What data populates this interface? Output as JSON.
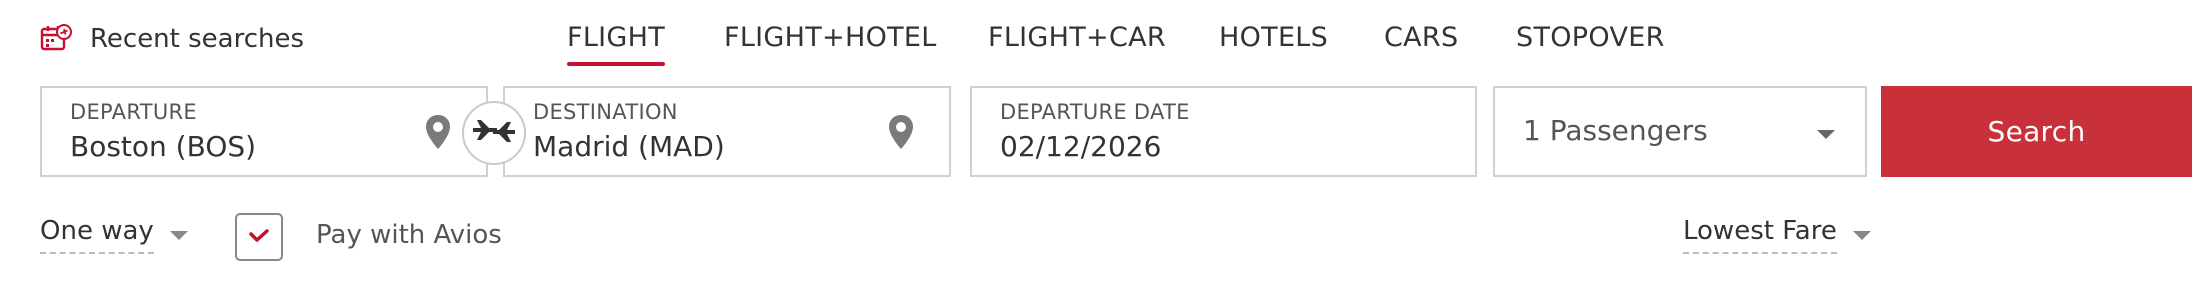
{
  "recent": {
    "label": "Recent searches",
    "icon": "calendar-plane-icon"
  },
  "tabs": [
    {
      "label": "FLIGHT",
      "active": true
    },
    {
      "label": "FLIGHT+HOTEL",
      "active": false
    },
    {
      "label": "FLIGHT+CAR",
      "active": false
    },
    {
      "label": "HOTELS",
      "active": false
    },
    {
      "label": "CARS",
      "active": false
    },
    {
      "label": "STOPOVER",
      "active": false
    }
  ],
  "form": {
    "departure": {
      "label": "DEPARTURE",
      "value": "Boston (BOS)",
      "icon": "map-pin-icon"
    },
    "destination": {
      "label": "DESTINATION",
      "value": "Madrid (MAD)",
      "icon": "map-pin-icon"
    },
    "swap": {
      "icon": "plane-swap-icon"
    },
    "date": {
      "label": "DEPARTURE DATE",
      "value": "02/12/2026"
    },
    "passengers": {
      "value": "1 Passengers"
    },
    "search_label": "Search"
  },
  "options": {
    "trip_type": "One way",
    "pay_with_avios": {
      "label": "Pay with Avios",
      "checked": true
    },
    "sort": "Lowest Fare"
  },
  "colors": {
    "accent": "#c8102e",
    "search_button": "#c8313a",
    "border": "#d0d0d0"
  }
}
